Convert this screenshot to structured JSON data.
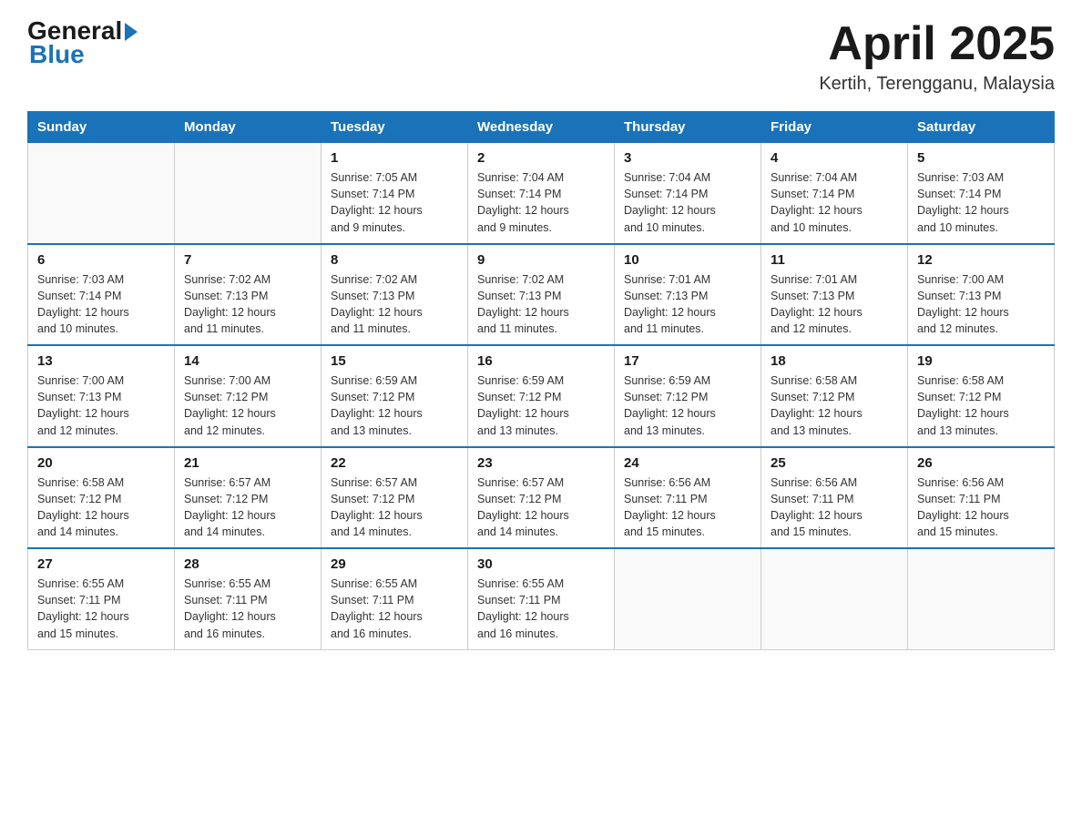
{
  "header": {
    "logo_general": "General",
    "logo_blue": "Blue",
    "month_year": "April 2025",
    "location": "Kertih, Terengganu, Malaysia"
  },
  "days_of_week": [
    "Sunday",
    "Monday",
    "Tuesday",
    "Wednesday",
    "Thursday",
    "Friday",
    "Saturday"
  ],
  "weeks": [
    [
      {
        "day": "",
        "info": ""
      },
      {
        "day": "",
        "info": ""
      },
      {
        "day": "1",
        "info": "Sunrise: 7:05 AM\nSunset: 7:14 PM\nDaylight: 12 hours\nand 9 minutes."
      },
      {
        "day": "2",
        "info": "Sunrise: 7:04 AM\nSunset: 7:14 PM\nDaylight: 12 hours\nand 9 minutes."
      },
      {
        "day": "3",
        "info": "Sunrise: 7:04 AM\nSunset: 7:14 PM\nDaylight: 12 hours\nand 10 minutes."
      },
      {
        "day": "4",
        "info": "Sunrise: 7:04 AM\nSunset: 7:14 PM\nDaylight: 12 hours\nand 10 minutes."
      },
      {
        "day": "5",
        "info": "Sunrise: 7:03 AM\nSunset: 7:14 PM\nDaylight: 12 hours\nand 10 minutes."
      }
    ],
    [
      {
        "day": "6",
        "info": "Sunrise: 7:03 AM\nSunset: 7:14 PM\nDaylight: 12 hours\nand 10 minutes."
      },
      {
        "day": "7",
        "info": "Sunrise: 7:02 AM\nSunset: 7:13 PM\nDaylight: 12 hours\nand 11 minutes."
      },
      {
        "day": "8",
        "info": "Sunrise: 7:02 AM\nSunset: 7:13 PM\nDaylight: 12 hours\nand 11 minutes."
      },
      {
        "day": "9",
        "info": "Sunrise: 7:02 AM\nSunset: 7:13 PM\nDaylight: 12 hours\nand 11 minutes."
      },
      {
        "day": "10",
        "info": "Sunrise: 7:01 AM\nSunset: 7:13 PM\nDaylight: 12 hours\nand 11 minutes."
      },
      {
        "day": "11",
        "info": "Sunrise: 7:01 AM\nSunset: 7:13 PM\nDaylight: 12 hours\nand 12 minutes."
      },
      {
        "day": "12",
        "info": "Sunrise: 7:00 AM\nSunset: 7:13 PM\nDaylight: 12 hours\nand 12 minutes."
      }
    ],
    [
      {
        "day": "13",
        "info": "Sunrise: 7:00 AM\nSunset: 7:13 PM\nDaylight: 12 hours\nand 12 minutes."
      },
      {
        "day": "14",
        "info": "Sunrise: 7:00 AM\nSunset: 7:12 PM\nDaylight: 12 hours\nand 12 minutes."
      },
      {
        "day": "15",
        "info": "Sunrise: 6:59 AM\nSunset: 7:12 PM\nDaylight: 12 hours\nand 13 minutes."
      },
      {
        "day": "16",
        "info": "Sunrise: 6:59 AM\nSunset: 7:12 PM\nDaylight: 12 hours\nand 13 minutes."
      },
      {
        "day": "17",
        "info": "Sunrise: 6:59 AM\nSunset: 7:12 PM\nDaylight: 12 hours\nand 13 minutes."
      },
      {
        "day": "18",
        "info": "Sunrise: 6:58 AM\nSunset: 7:12 PM\nDaylight: 12 hours\nand 13 minutes."
      },
      {
        "day": "19",
        "info": "Sunrise: 6:58 AM\nSunset: 7:12 PM\nDaylight: 12 hours\nand 13 minutes."
      }
    ],
    [
      {
        "day": "20",
        "info": "Sunrise: 6:58 AM\nSunset: 7:12 PM\nDaylight: 12 hours\nand 14 minutes."
      },
      {
        "day": "21",
        "info": "Sunrise: 6:57 AM\nSunset: 7:12 PM\nDaylight: 12 hours\nand 14 minutes."
      },
      {
        "day": "22",
        "info": "Sunrise: 6:57 AM\nSunset: 7:12 PM\nDaylight: 12 hours\nand 14 minutes."
      },
      {
        "day": "23",
        "info": "Sunrise: 6:57 AM\nSunset: 7:12 PM\nDaylight: 12 hours\nand 14 minutes."
      },
      {
        "day": "24",
        "info": "Sunrise: 6:56 AM\nSunset: 7:11 PM\nDaylight: 12 hours\nand 15 minutes."
      },
      {
        "day": "25",
        "info": "Sunrise: 6:56 AM\nSunset: 7:11 PM\nDaylight: 12 hours\nand 15 minutes."
      },
      {
        "day": "26",
        "info": "Sunrise: 6:56 AM\nSunset: 7:11 PM\nDaylight: 12 hours\nand 15 minutes."
      }
    ],
    [
      {
        "day": "27",
        "info": "Sunrise: 6:55 AM\nSunset: 7:11 PM\nDaylight: 12 hours\nand 15 minutes."
      },
      {
        "day": "28",
        "info": "Sunrise: 6:55 AM\nSunset: 7:11 PM\nDaylight: 12 hours\nand 16 minutes."
      },
      {
        "day": "29",
        "info": "Sunrise: 6:55 AM\nSunset: 7:11 PM\nDaylight: 12 hours\nand 16 minutes."
      },
      {
        "day": "30",
        "info": "Sunrise: 6:55 AM\nSunset: 7:11 PM\nDaylight: 12 hours\nand 16 minutes."
      },
      {
        "day": "",
        "info": ""
      },
      {
        "day": "",
        "info": ""
      },
      {
        "day": "",
        "info": ""
      }
    ]
  ]
}
